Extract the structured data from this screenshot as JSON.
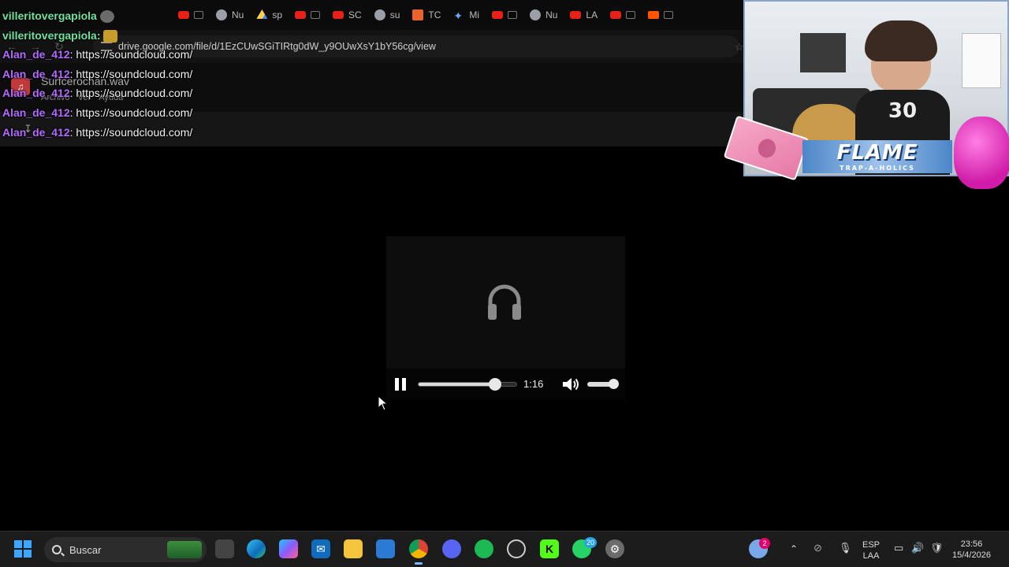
{
  "browser": {
    "tabs": [
      {
        "label": "",
        "icon": "youtube-icon"
      },
      {
        "label": "Nu",
        "icon": "chrome-icon"
      },
      {
        "label": "sp",
        "icon": "drive-icon"
      },
      {
        "label": "",
        "icon": "youtube-icon"
      },
      {
        "label": "SC",
        "icon": "youtube-icon"
      },
      {
        "label": "su",
        "icon": "google-icon"
      },
      {
        "label": "TC",
        "icon": "t-icon"
      },
      {
        "label": "Mi",
        "icon": "gemini-icon"
      },
      {
        "label": "",
        "icon": "youtube-icon"
      },
      {
        "label": "Nu",
        "icon": "chrome-icon"
      },
      {
        "label": "LA",
        "icon": "youtube-icon"
      },
      {
        "label": "",
        "icon": "youtube-icon"
      },
      {
        "label": "",
        "icon": "soundcloud-icon"
      }
    ],
    "url": "drive.google.com/file/d/1EzCUwSGiTIRtg0dW_y9OUwXsY1bY56cg/view"
  },
  "drive": {
    "file_name": "Surfcerochan.wav",
    "menu": [
      "Archivo",
      "Ver",
      "Ayuda"
    ]
  },
  "chat": {
    "lines": [
      {
        "user": "villeritovergapiola",
        "message": ""
      },
      {
        "user": "villeritovergapiola:",
        "message": ""
      },
      {
        "user": "Alan_de_412",
        "message": ": https://soundcloud.com/"
      },
      {
        "user": "Alan_de_412",
        "message": ": https://soundcloud.com/"
      },
      {
        "user": "Alan_de_412",
        "message": ": https://soundcloud.com/"
      },
      {
        "user": "Alan_de_412",
        "message": ": https://soundcloud.com/"
      },
      {
        "user": "Alan_de_412",
        "message": ": https://soundcloud.com/"
      }
    ]
  },
  "overlay": {
    "banner": "FLAME",
    "banner_sub": "TRAP-A-HOLICS",
    "shirt_text": "30"
  },
  "player": {
    "icon": "headphones-icon",
    "time": "1:16",
    "progress": 0.78,
    "volume": 0.9
  },
  "taskbar": {
    "search_placeholder": "Buscar",
    "lang_top": "ESP",
    "lang_bottom": "LAA",
    "time": "23:56",
    "date": "15/4/2026",
    "weather_badge": "2",
    "whatsapp_badge": "20"
  },
  "colors": {
    "chat_user_green": "#6fe3a0",
    "chat_user_purple": "#b36bff",
    "accent_blue": "#3ea6ff"
  }
}
